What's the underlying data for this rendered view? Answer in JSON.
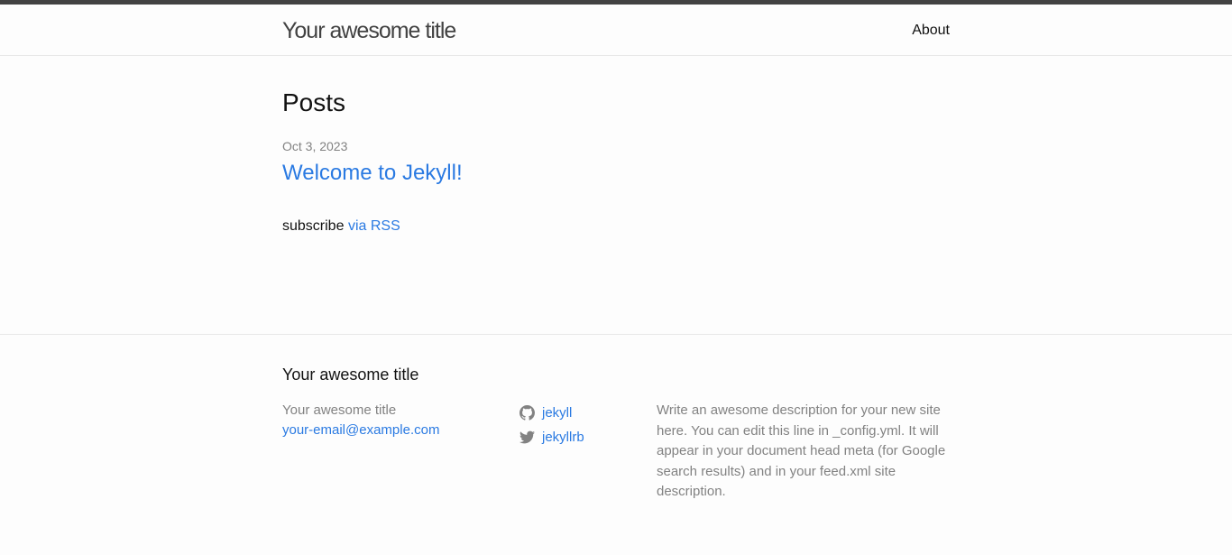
{
  "header": {
    "site_title": "Your awesome title",
    "nav": [
      {
        "label": "About"
      }
    ]
  },
  "main": {
    "heading": "Posts",
    "posts": [
      {
        "date": "Oct 3, 2023",
        "title": "Welcome to Jekyll!"
      }
    ],
    "rss": {
      "prefix": "subscribe",
      "link_label": "via RSS"
    }
  },
  "footer": {
    "heading": "Your awesome title",
    "contact": {
      "name": "Your awesome title",
      "email": "your-email@example.com"
    },
    "social": [
      {
        "icon": "github-icon",
        "label": "jekyll"
      },
      {
        "icon": "twitter-icon",
        "label": "jekyllrb"
      }
    ],
    "description": "Write an awesome description for your new site here. You can edit this line in _config.yml. It will appear in your document head meta (for Google search results) and in your feed.xml site description."
  },
  "colors": {
    "link": "#2a7ae2",
    "muted": "#828282",
    "header_border": "#424242",
    "text": "#111111"
  }
}
